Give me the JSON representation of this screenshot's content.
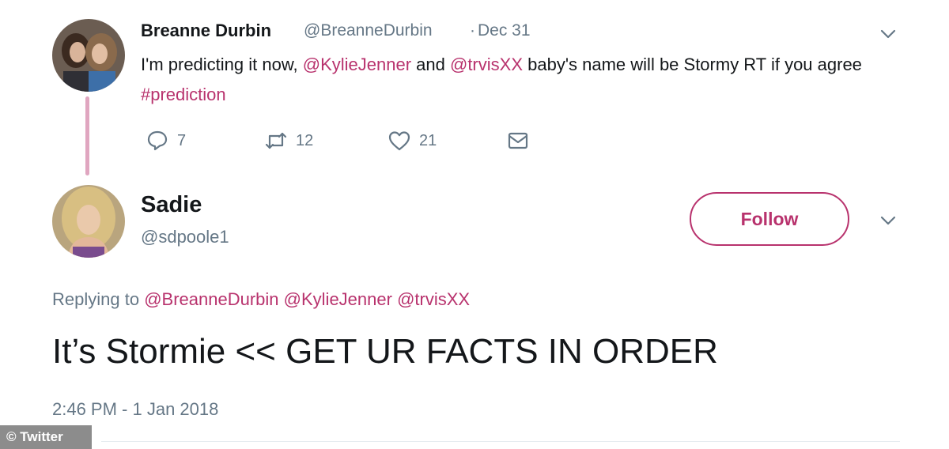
{
  "colors": {
    "accent": "#b8326d",
    "muted": "#657786",
    "text": "#14171a",
    "thread": "#e0a6c0"
  },
  "tweet1": {
    "name": "Breanne Durbin",
    "handle": "@BreanneDurbin",
    "separator": "·",
    "date": "Dec 31",
    "text_parts": {
      "p1": "I'm predicting it now, ",
      "mention1": "@KylieJenner",
      "p2": " and ",
      "mention2": "@trvisXX",
      "p3": " baby's name will be Stormy RT if you agree ",
      "hashtag": "#prediction"
    },
    "actions": {
      "reply_count": "7",
      "retweet_count": "12",
      "like_count": "21"
    },
    "icons": {
      "reply": "reply-icon",
      "retweet": "retweet-icon",
      "like": "heart-icon",
      "dm": "envelope-icon",
      "menu": "chevron-down-icon"
    }
  },
  "tweet2": {
    "name": "Sadie",
    "handle": "@sdpoole1",
    "follow_label": "Follow",
    "replying_label": "Replying to",
    "replying_mentions": {
      "m1": "@BreanneDurbin",
      "m2": "@KylieJenner",
      "m3": "@trvisXX"
    },
    "text": "It’s Stormie << GET UR FACTS IN ORDER",
    "timestamp": "2:46 PM - 1 Jan 2018"
  },
  "credit": "© Twitter"
}
